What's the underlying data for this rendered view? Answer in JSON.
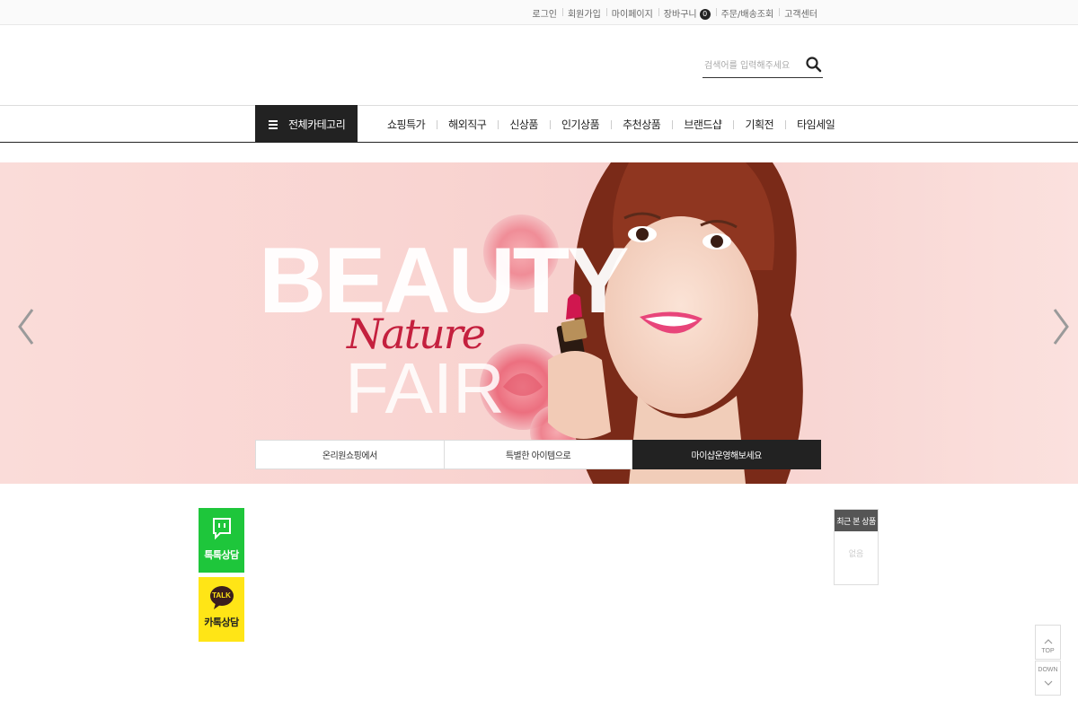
{
  "topbar": {
    "links": [
      "로그인",
      "회원가입",
      "마이페이지",
      "장바구니",
      "주문/배송조회",
      "고객센터"
    ],
    "cart_count": "0"
  },
  "search": {
    "placeholder": "검색어를 입력해주세요"
  },
  "nav": {
    "all_category": "전체카테고리",
    "items": [
      "쇼핑특가",
      "해외직구",
      "신상품",
      "인기상품",
      "추천상품",
      "브랜드샵",
      "기획전",
      "타임세일"
    ]
  },
  "banner": {
    "headline": "BEAUTY",
    "script": "Nature",
    "sub": "FAIR",
    "tabs": [
      "온리원쇼핑에서",
      "특별한 아이템으로",
      "마이샵운영해보세요"
    ],
    "active_tab": 2,
    "bg_color": "#fad9d6"
  },
  "chat": {
    "talk_label": "톡톡상담",
    "kakao_label": "카톡상담",
    "kakao_bubble": "TALK",
    "talk_color": "#1ec63b",
    "kakao_color": "#ffe516"
  },
  "recent": {
    "title": "최근 본 상품",
    "empty": "없음"
  },
  "scroll": {
    "top": "TOP",
    "down": "DOWN"
  }
}
